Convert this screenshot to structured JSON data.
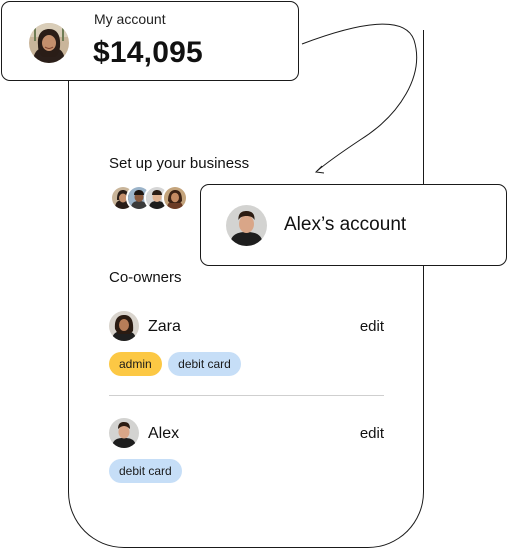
{
  "account": {
    "label": "My account",
    "balance": "$14,095"
  },
  "business": {
    "title": "Set up your business"
  },
  "alex_card": {
    "name": "Alex’s account"
  },
  "coowners": {
    "title": "Co-owners",
    "owners": [
      {
        "name": "Zara",
        "edit_label": "edit",
        "tags": [
          {
            "label": "admin"
          },
          {
            "label": "debit card"
          }
        ]
      },
      {
        "name": "Alex",
        "edit_label": "edit",
        "tags": [
          {
            "label": "debit card"
          }
        ]
      }
    ]
  },
  "colors": {
    "tag_admin": "#fcc844",
    "tag_debit": "#c6def7",
    "outline": "#1a1a1a"
  },
  "icons": {
    "connector": "curved-arrow-icon"
  }
}
